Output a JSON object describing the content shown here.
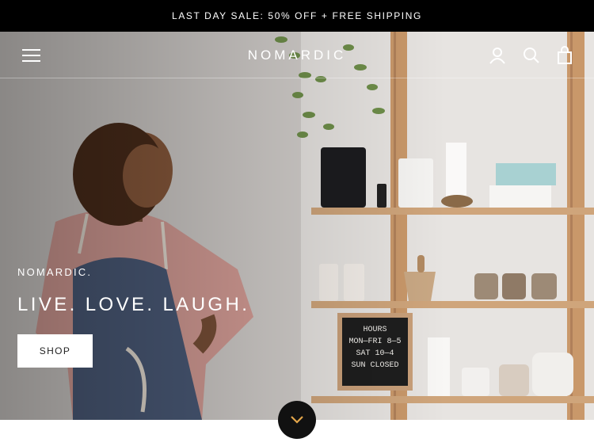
{
  "announcement": {
    "text": "LAST DAY SALE: 50% OFF + FREE SHIPPING"
  },
  "header": {
    "logo": "NOMARDIC",
    "icons": [
      "menu-icon",
      "account-icon",
      "search-icon",
      "cart-icon"
    ]
  },
  "hero": {
    "brand": "NOMARDIC.",
    "headline": "LIVE. LOVE. LAUGH.",
    "button_label": "SHOP",
    "chalkboard": {
      "title": "HOURS",
      "lines": [
        "MON—FRI 8—5",
        "SAT 10—4",
        "SUN CLOSED"
      ]
    }
  },
  "scroll_button": {
    "icon": "chevron-down-icon"
  },
  "colors": {
    "bar": "#000000",
    "accent": "#e3a64a",
    "button": "#ffffff"
  }
}
